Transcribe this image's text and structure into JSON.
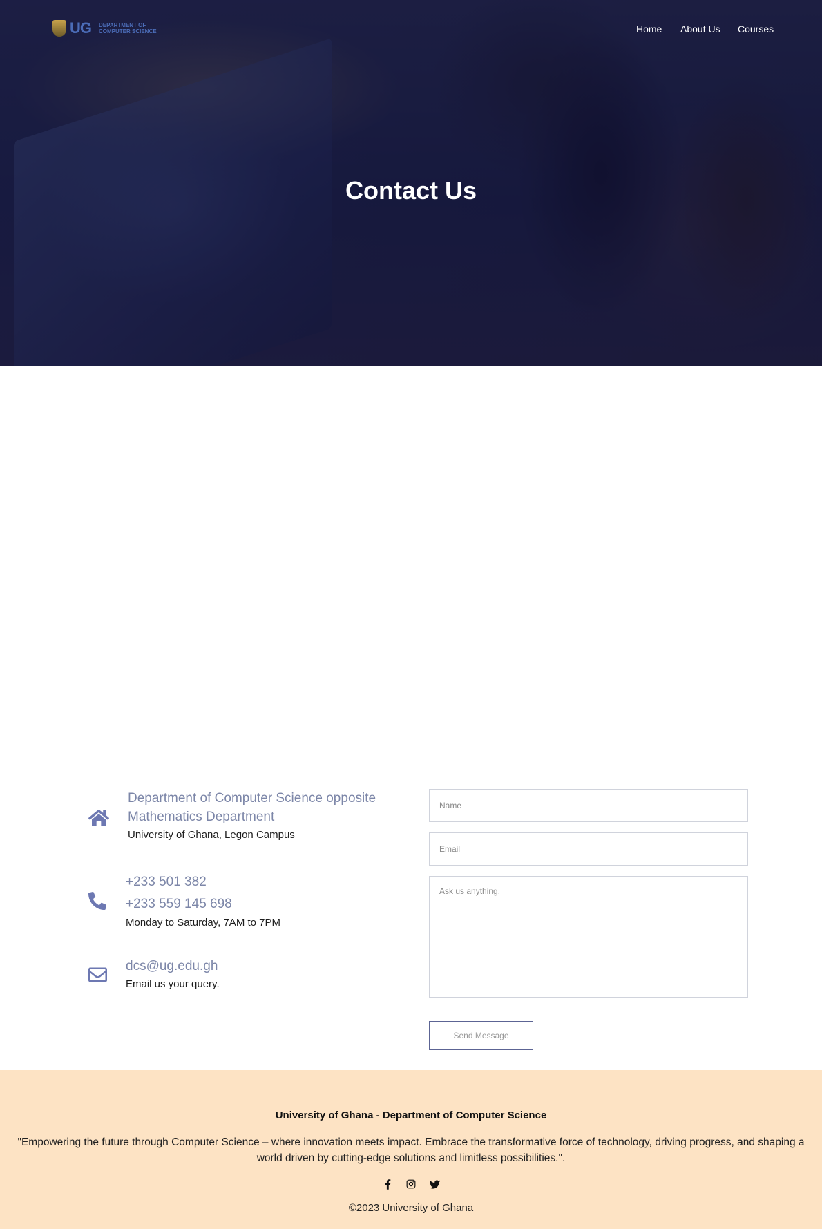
{
  "header": {
    "logo": {
      "short": "UG",
      "line1": "DEPARTMENT OF",
      "line2": "COMPUTER SCIENCE"
    },
    "nav": [
      "Home",
      "About Us",
      "Courses"
    ]
  },
  "hero": {
    "title": "Contact Us"
  },
  "contact": {
    "address": {
      "icon": "home-icon",
      "title_line1": "Department of Computer Science opposite",
      "title_line2": "Mathematics Department",
      "sub": "University of Ghana, Legon Campus"
    },
    "phone": {
      "icon": "phone-icon",
      "number1": "+233 501 382",
      "number2": "+233 559 145 698",
      "sub": "Monday to Saturday, 7AM to 7PM"
    },
    "email": {
      "icon": "envelope-icon",
      "address": "dcs@ug.edu.gh",
      "sub": "Email us your query."
    }
  },
  "form": {
    "name_placeholder": "Name",
    "email_placeholder": "Email",
    "message_placeholder": "Ask us anything.",
    "send_label": "Send Message"
  },
  "footer": {
    "title": "University of Ghana - Department of Computer Science",
    "quote": "\"Empowering the future through Computer Science – where innovation meets impact. Embrace the transformative force of technology, driving progress, and shaping a world driven by cutting-edge solutions and limitless possibilities.\".",
    "socials": [
      "facebook-icon",
      "instagram-icon",
      "twitter-icon"
    ],
    "copyright": "©2023 University of Ghana"
  },
  "colors": {
    "accent": "#6d78b2",
    "footer_bg": "#fde3c4",
    "hero_overlay": "#10123a"
  }
}
